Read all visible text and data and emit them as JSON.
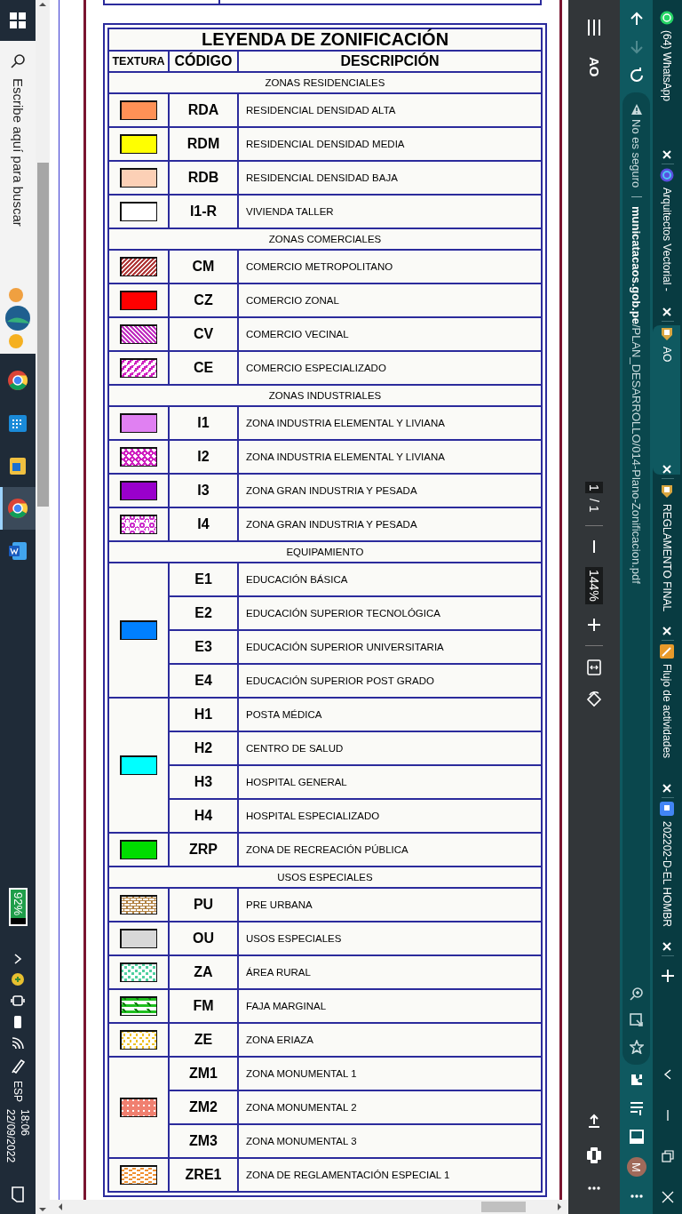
{
  "taskbar": {
    "search": {
      "placeholder": "Escribe aquí para buscar"
    },
    "apps": [
      {
        "kind": "browser",
        "selected": false
      },
      {
        "kind": "calendar",
        "selected": false
      },
      {
        "kind": "app",
        "selected": false
      },
      {
        "kind": "browser",
        "selected": true
      },
      {
        "kind": "document",
        "selected": false
      }
    ],
    "battery": "92%",
    "language": "ESP",
    "time": "18:06",
    "date": "22/09/2022"
  },
  "legend": {
    "title": "LEYENDA DE ZONIFICACIÓN",
    "columns": [
      "TEXTURA",
      "CÓDIGO",
      "DESCRIPCIÓN"
    ],
    "sections": [
      {
        "title": "ZONAS RESIDENCIALES",
        "groups": [
          {
            "kind": "solid",
            "color": "#ff9156",
            "items": [
              {
                "code": "RDA",
                "description": "RESIDENCIAL DENSIDAD ALTA"
              }
            ]
          },
          {
            "kind": "solid",
            "color": "#ffff00",
            "items": [
              {
                "code": "RDM",
                "description": "RESIDENCIAL DENSIDAD MEDIA"
              }
            ]
          },
          {
            "kind": "solid",
            "color": "#fcd0b6",
            "items": [
              {
                "code": "RDB",
                "description": "RESIDENCIAL DENSIDAD BAJA"
              }
            ]
          },
          {
            "kind": "solid",
            "color": "#ffffff",
            "items": [
              {
                "code": "I1-R",
                "description": "VIVIENDA TALLER"
              }
            ]
          }
        ]
      },
      {
        "title": "ZONAS COMERCIALES",
        "groups": [
          {
            "kind": "hatch",
            "color": "#b03a3a",
            "items": [
              {
                "code": "CM",
                "description": "COMERCIO METROPOLITANO"
              }
            ]
          },
          {
            "kind": "solid",
            "color": "#ff0000",
            "items": [
              {
                "code": "CZ",
                "description": "COMERCIO ZONAL"
              }
            ]
          },
          {
            "kind": "backhatch",
            "color": "#c030c0",
            "items": [
              {
                "code": "CV",
                "description": "COMERCIO VECINAL"
              }
            ]
          },
          {
            "kind": "zigzag",
            "color": "#d020c0",
            "items": [
              {
                "code": "CE",
                "description": "COMERCIO ESPECIALIZADO"
              }
            ]
          }
        ]
      },
      {
        "title": "ZONAS INDUSTRIALES",
        "groups": [
          {
            "kind": "solid",
            "color": "#e080f2",
            "items": [
              {
                "code": "I1",
                "description": "ZONA INDUSTRIA ELEMENTAL Y LIVIANA"
              }
            ]
          },
          {
            "kind": "hexagons",
            "color": "#d020c0",
            "items": [
              {
                "code": "I2",
                "description": "ZONA INDUSTRIA ELEMENTAL Y LIVIANA"
              }
            ]
          },
          {
            "kind": "solid",
            "color": "#9900cc",
            "items": [
              {
                "code": "I3",
                "description": "ZONA GRAN INDUSTRIA Y PESADA"
              }
            ]
          },
          {
            "kind": "circles",
            "color": "#cc30cc",
            "items": [
              {
                "code": "I4",
                "description": "ZONA GRAN INDUSTRIA Y PESADA"
              }
            ]
          }
        ]
      },
      {
        "title": "EQUIPAMIENTO",
        "groups": [
          {
            "kind": "solid",
            "color": "#0080ff",
            "items": [
              {
                "code": "E1",
                "description": "EDUCACIÓN BÁSICA"
              },
              {
                "code": "E2",
                "description": "EDUCACIÓN SUPERIOR TECNOLÓGICA"
              },
              {
                "code": "E3",
                "description": "EDUCACIÓN SUPERIOR UNIVERSITARIA"
              },
              {
                "code": "E4",
                "description": "EDUCACIÓN SUPERIOR POST GRADO"
              }
            ]
          },
          {
            "kind": "solid",
            "color": "#00ffff",
            "items": [
              {
                "code": "H1",
                "description": "POSTA MÉDICA"
              },
              {
                "code": "H2",
                "description": "CENTRO DE SALUD"
              },
              {
                "code": "H3",
                "description": "HOSPITAL GENERAL"
              },
              {
                "code": "H4",
                "description": "HOSPITAL ESPECIALIZADO"
              }
            ]
          },
          {
            "kind": "solid",
            "color": "#00dd00",
            "items": [
              {
                "code": "ZRP",
                "description": "ZONA DE RECREACIÓN PÚBLICA"
              }
            ]
          }
        ]
      },
      {
        "title": "USOS ESPECIALES",
        "groups": [
          {
            "kind": "bricks",
            "color": "#b08040",
            "items": [
              {
                "code": "PU",
                "description": "PRE URBANA"
              }
            ]
          },
          {
            "kind": "solid",
            "color": "#d8d8d8",
            "items": [
              {
                "code": "OU",
                "description": "USOS ESPECIALES"
              }
            ]
          },
          {
            "kind": "dots",
            "color": "#50d0a0",
            "items": [
              {
                "code": "ZA",
                "description": "ÁREA RURAL"
              }
            ]
          },
          {
            "kind": "stripes",
            "color": "#20c020",
            "items": [
              {
                "code": "FM",
                "description": "FAJA MARGINAL"
              }
            ]
          },
          {
            "kind": "speckle",
            "color": "#f0c020",
            "items": [
              {
                "code": "ZE",
                "description": "ZONA ERIAZA"
              }
            ]
          },
          {
            "kind": "squares",
            "color": "#f08070",
            "items": [
              {
                "code": "ZM1",
                "description": "ZONA MONUMENTAL 1"
              },
              {
                "code": "ZM2",
                "description": "ZONA MONUMENTAL 2"
              },
              {
                "code": "ZM3",
                "description": "ZONA MONUMENTAL 3"
              }
            ]
          },
          {
            "kind": "dashes",
            "color": "#f09030",
            "items": [
              {
                "code": "ZRE1",
                "description": "ZONA DE REGLAMENTACIÓN ESPECIAL 1"
              }
            ]
          }
        ]
      }
    ]
  },
  "pdf_toolbar": {
    "title": "AO",
    "page": "1",
    "page_total": "/ 1",
    "zoom": "144%"
  },
  "address_bar": {
    "security": "No es seguro",
    "url": "**municatacaos.gob.pe**/PLAN_DESARROLLO/014-Plano-Zonificacion.pdf"
  },
  "profile": {
    "initial": "M"
  },
  "tabs": [
    {
      "kind": "chat",
      "title": "(64) WhatsApp",
      "selected": false
    },
    {
      "kind": "circle",
      "title": "Arquitectos Vectorial -",
      "selected": false
    },
    {
      "kind": "crest",
      "title": "AO",
      "selected": true
    },
    {
      "kind": "crest",
      "title": "REGLAMENTO FINAL",
      "selected": false
    },
    {
      "kind": "pencil",
      "title": "Flujo de actividades",
      "selected": false
    },
    {
      "kind": "slides",
      "title": "202202-D-EL HOMBR",
      "selected": false
    }
  ]
}
